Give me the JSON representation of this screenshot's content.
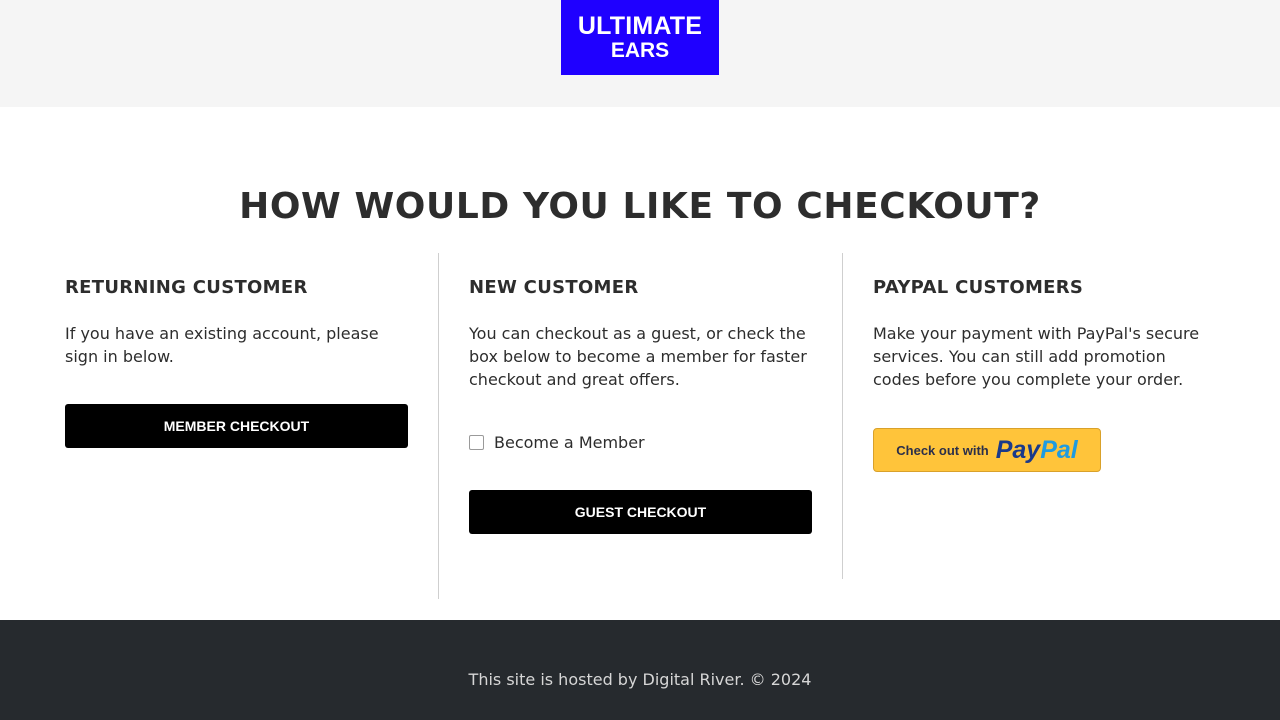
{
  "header": {
    "logo_line1": "ULTIMATE",
    "logo_line2": "EARS",
    "logo_color": "#1f00ff"
  },
  "main": {
    "title": "HOW WOULD YOU LIKE TO CHECKOUT?",
    "returning": {
      "heading": "RETURNING CUSTOMER",
      "description": "If you have an existing account, please sign in below.",
      "button_label": "MEMBER CHECKOUT"
    },
    "new_customer": {
      "heading": "NEW CUSTOMER",
      "description": "You can checkout as a guest, or check the box below to become a member for faster checkout and great offers.",
      "checkbox_label": "Become a Member",
      "checkbox_checked": false,
      "button_label": "GUEST CHECKOUT"
    },
    "paypal": {
      "heading": "PAYPAL CUSTOMERS",
      "description": "Make your payment with PayPal's secure services. You can still add promotion codes before you complete your order.",
      "button_prefix": "Check out with",
      "logo_pay": "Pay",
      "logo_pal": "Pal",
      "button_color": "#ffc43a"
    }
  },
  "footer": {
    "text": "This site is hosted by Digital River. © 2024"
  }
}
